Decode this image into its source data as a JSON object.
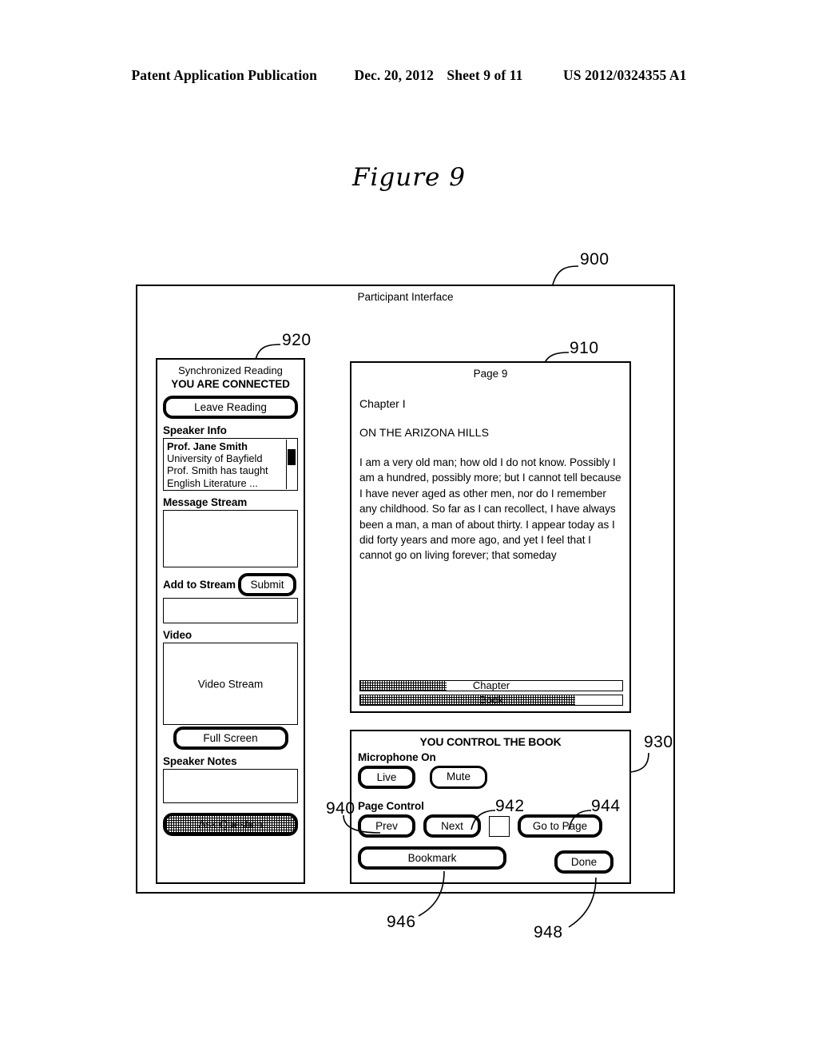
{
  "patent_header": {
    "publication": "Patent Application Publication",
    "date": "Dec. 20, 2012",
    "sheet": "Sheet 9 of 11",
    "number": "US 2012/0324355 A1"
  },
  "figure": {
    "title": "Figure 9"
  },
  "interface": {
    "title": "Participant Interface",
    "ref": "900"
  },
  "sidebar": {
    "ref": "920",
    "sync_label": "Synchronized Reading",
    "status": "YOU ARE CONNECTED",
    "leave_button": "Leave Reading",
    "speaker_info_label": "Speaker Info",
    "speaker_info_lines": [
      "Prof. Jane Smith",
      "University of Bayfield",
      "Prof. Smith has taught",
      "English Literature ..."
    ],
    "message_stream_label": "Message Stream",
    "message_stream_value": "",
    "add_to_stream_label": "Add to Stream",
    "submit_button": "Submit",
    "add_to_stream_value": "",
    "video_label": "Video",
    "video_stream_text": "Video Stream",
    "full_screen_button": "Full Screen",
    "speaker_notes_label": "Speaker Notes",
    "speaker_notes_value": "",
    "ask_question_button": "Ask Question"
  },
  "reading_pane": {
    "ref": "910",
    "page_number": "Page 9",
    "chapter": "Chapter I",
    "chapter_title": "ON THE ARIZONA HILLS",
    "body": "I am a very old man; how old I do not know. Possibly I am a hundred, possibly more; but I cannot tell because I have never aged as other men, nor do I remember any childhood. So far as I can recollect, I have always been a man, a man of about thirty. I appear today as I did forty years and more ago, and yet I feel that I cannot go on living forever; that someday",
    "progress": [
      {
        "label": "Chapter",
        "percent": 33
      },
      {
        "label": "Book",
        "percent": 82
      }
    ]
  },
  "control_panel": {
    "ref": "930",
    "title": "YOU CONTROL THE BOOK",
    "microphone_label": "Microphone On",
    "live_button": "Live",
    "mute_button": "Mute",
    "page_control_label": "Page Control",
    "prev_button": "Prev",
    "prev_ref": "940",
    "next_button": "Next",
    "next_ref": "942",
    "page_input_value": "",
    "goto_button": "Go to Page",
    "goto_ref": "944",
    "bookmark_button": "Bookmark",
    "bookmark_ref": "946",
    "done_button": "Done",
    "done_ref": "948"
  },
  "colors": {
    "ink": "#000000",
    "paper": "#ffffff"
  }
}
